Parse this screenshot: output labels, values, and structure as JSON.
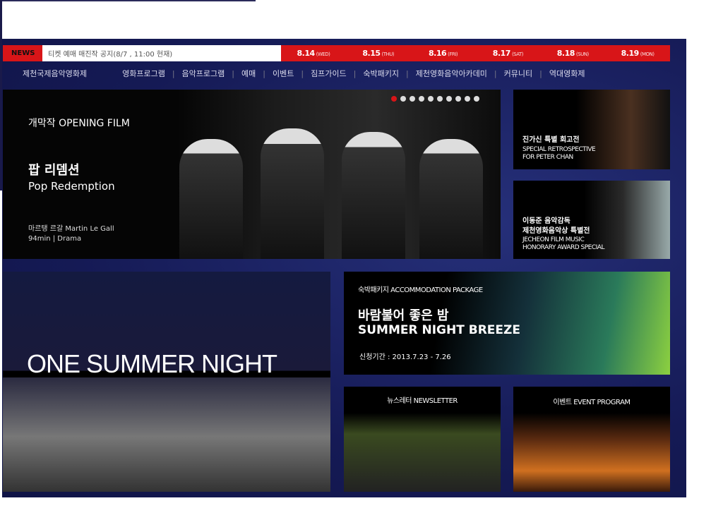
{
  "news": {
    "label": "NEWS",
    "text": "티켓 예매 매진작 공지(8/7 , 11:00 현재)"
  },
  "dates": [
    {
      "date": "8.14",
      "day": "(WED)"
    },
    {
      "date": "8.15",
      "day": "(THU)"
    },
    {
      "date": "8.16",
      "day": "(FRI)"
    },
    {
      "date": "8.17",
      "day": "(SAT)"
    },
    {
      "date": "8.18",
      "day": "(SUN)"
    },
    {
      "date": "8.19",
      "day": "(MON)"
    }
  ],
  "nav": [
    "제천국제음악영화제",
    "영화프로그램",
    "음악프로그램",
    "예매",
    "이벤트",
    "짐프가이드",
    "숙박패키지",
    "제천영화음악아카데미",
    "커뮤니티",
    "역대영화제"
  ],
  "main": {
    "label": "개막작 OPENING FILM",
    "title_kr": "팝 리뎀션",
    "title_en": "Pop Redemption",
    "director": "마르탱 르갈   Martin Le Gall",
    "info": "94min  |  Drama",
    "slides": 10,
    "active_slide": 1
  },
  "side1": {
    "kr": "진가신 특별 회고전",
    "en1": "SPECIAL RETROSPECTIVE",
    "en2": "FOR PETER CHAN"
  },
  "side2": {
    "kr1": "이동준 음악감독",
    "kr2": "제천영화음악상 특별전",
    "en1": "JECHEON FILM MUSIC",
    "en2": "HONORARY AWARD SPECIAL"
  },
  "osn": {
    "title": "ONE SUMMER NIGHT"
  },
  "acc": {
    "label": "숙박패키지  ACCOMMODATION PACKAGE",
    "kr": "바람불어 좋은 밤",
    "en": "SUMMER NIGHT BREEZE",
    "period": "신청기간 : 2013.7.23 - 7.26"
  },
  "newsletter": {
    "label": "뉴스레터 NEWSLETTER"
  },
  "event": {
    "label": "이벤트 EVENT PROGRAM"
  },
  "colors": {
    "accent": "#d81518",
    "bg": "#151a55"
  }
}
